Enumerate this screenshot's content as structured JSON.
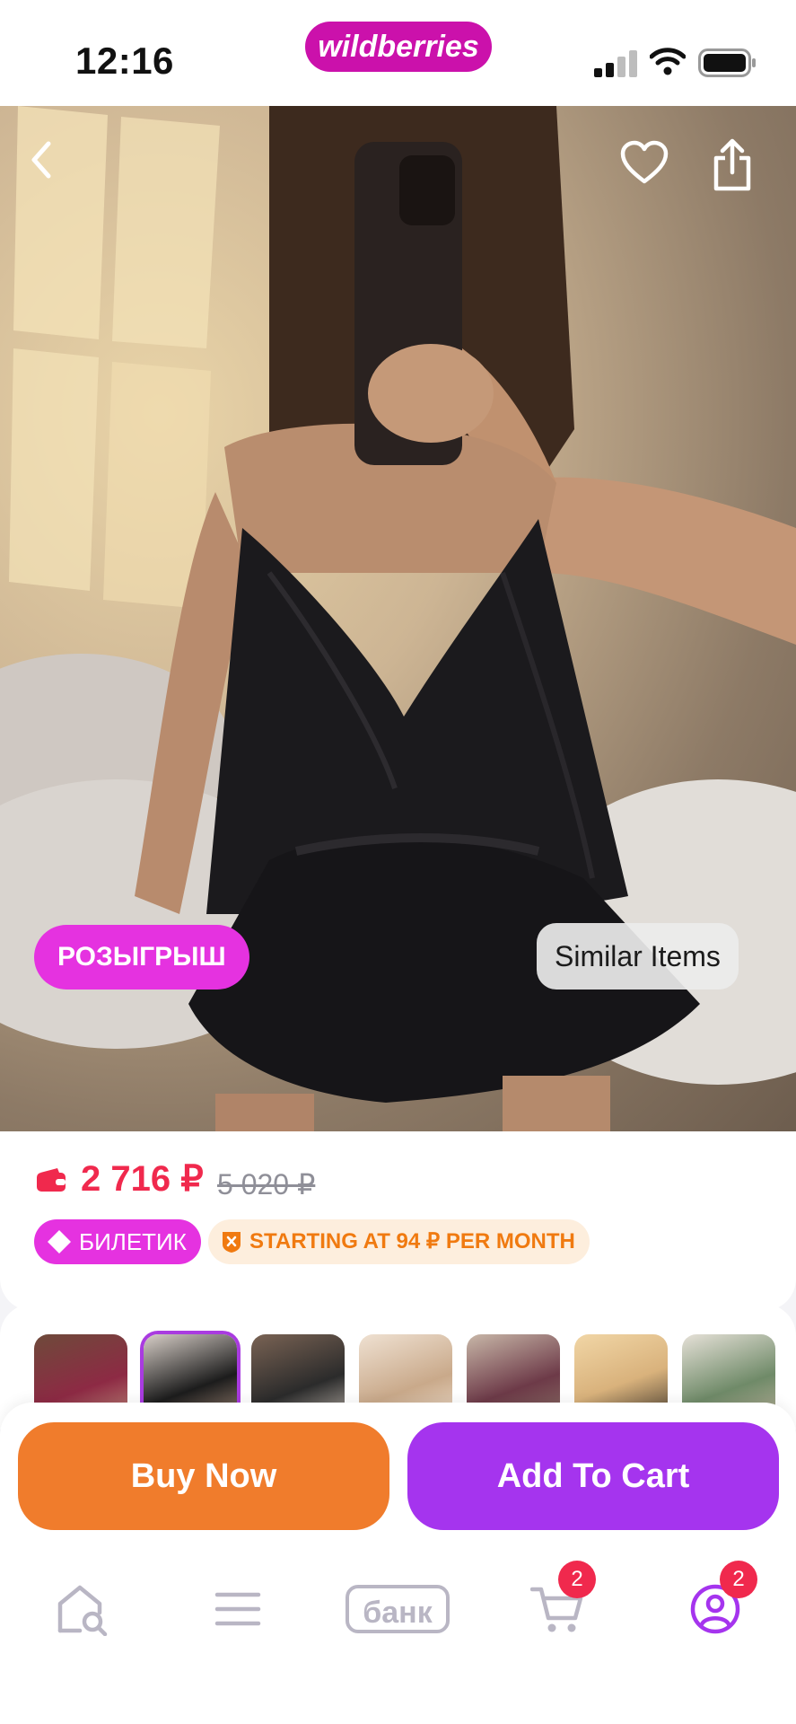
{
  "status_bar": {
    "time": "12:16",
    "brand": "wildberries"
  },
  "hero": {
    "raffle_label": "РОЗЫГРЫШ",
    "similar_label": "Similar Items"
  },
  "product": {
    "price": "2 716 ₽",
    "old_price": "5 020 ₽",
    "ticket_label": "БИЛЕТИК",
    "installment_label": "STARTING AT 94 ₽ PER MONTH"
  },
  "thumbnails": [
    {
      "color": "#8d2a44"
    },
    {
      "color": "#1c1c1c",
      "selected": true
    },
    {
      "color": "#2b2b2b"
    },
    {
      "color": "#c9a98a"
    },
    {
      "color": "#6d3a48"
    },
    {
      "color": "#d9b27c"
    },
    {
      "color": "#6f8a68"
    }
  ],
  "actions": {
    "buy_label": "Buy Now",
    "cart_label": "Add To Cart"
  },
  "tab_bar": {
    "bank_label": "банк",
    "cart_badge": "2",
    "profile_badge": "2"
  },
  "colors": {
    "brand": "#cb11ab",
    "price": "#f0294d",
    "buy": "#f07c2c",
    "cart": "#a534ee",
    "raffle": "#e532e0"
  }
}
